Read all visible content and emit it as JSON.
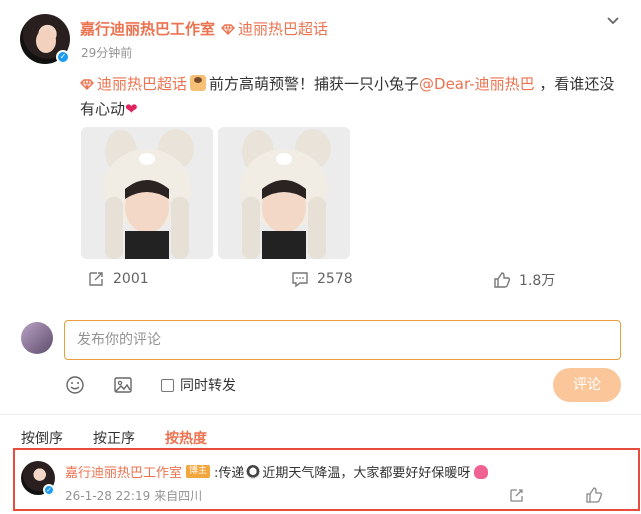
{
  "post": {
    "author": "嘉行迪丽热巴工作室",
    "topic_label": "迪丽热巴超话",
    "time": "29分钟前",
    "body_topic": "迪丽热巴超话",
    "body_text_1": "前方高萌预警！捕获一只小兔子",
    "mention": "@Dear-迪丽热巴",
    "body_text_2": " ，看谁还没有心动",
    "heart": "❤"
  },
  "actions": {
    "repost_count": "2001",
    "comment_count": "2578",
    "like_count": "1.8万"
  },
  "compose": {
    "placeholder": "发布你的评论",
    "repost_label": "同时转发",
    "submit_label": "评论"
  },
  "sort": {
    "options": [
      "按倒序",
      "按正序",
      "按热度"
    ],
    "active": "按热度"
  },
  "comment": {
    "author": "嘉行迪丽热巴工作室",
    "badge": "博主",
    "text_prefix": ":传递",
    "text_main": "近期天气降温，大家都要好好保暖呀",
    "time": "26-1-28 22:19",
    "location": "来自四川"
  },
  "colors": {
    "accent": "#eb7350",
    "highlight_border": "#e74c3c",
    "submit_disabled": "#fbc79a"
  }
}
